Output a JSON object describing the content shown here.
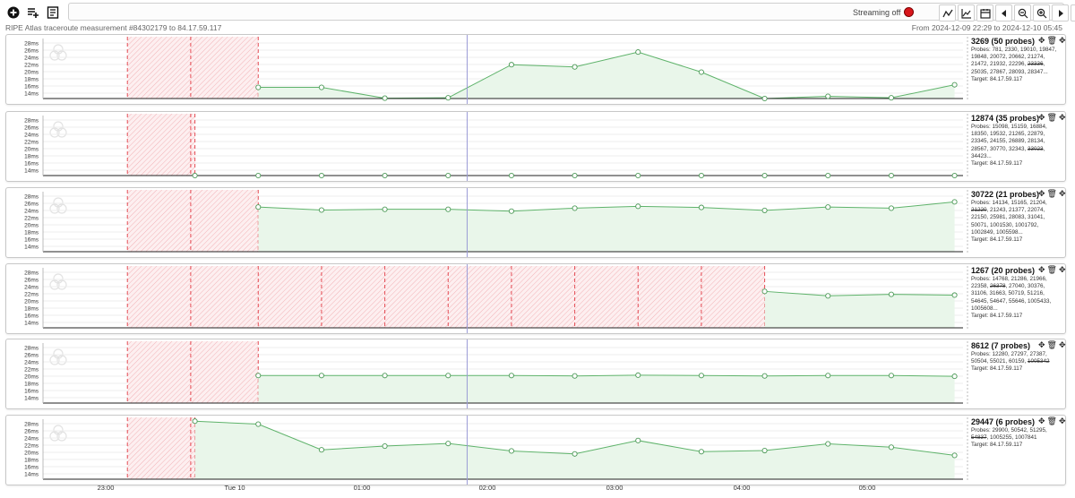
{
  "toolbar": {
    "left_buttons": [
      {
        "name": "add-probe-button",
        "icon": "plus-circle-icon"
      },
      {
        "name": "add-list-button",
        "icon": "playlist-add-icon"
      },
      {
        "name": "open-report-button",
        "icon": "document-icon"
      }
    ],
    "streaming_label": "Streaming off",
    "right_buttons": [
      {
        "name": "line-chart-button",
        "icon": "line-chart-icon"
      },
      {
        "name": "area-chart-button",
        "icon": "area-chart-icon"
      },
      {
        "name": "calendar-button",
        "icon": "calendar-icon"
      },
      {
        "name": "step-back-button",
        "icon": "caret-left-icon"
      },
      {
        "name": "zoom-out-button",
        "icon": "zoom-out-icon"
      },
      {
        "name": "zoom-in-button",
        "icon": "zoom-in-icon"
      },
      {
        "name": "step-forward-button",
        "icon": "caret-right-icon"
      },
      {
        "name": "skip-end-button",
        "icon": "skip-end-icon"
      }
    ]
  },
  "header": {
    "measurement_title": "RIPE Atlas traceroute measurement #84302179 to 84.17.59.117",
    "time_range": "From 2024-12-09 22:29 to 2024-12-10 05:45"
  },
  "colors": {
    "line": "#5fb36b",
    "fill": "#e9f6ea",
    "missing": "#e0303a",
    "cursor": "#9b9bd6",
    "streaming_dot": "#d8161b"
  },
  "axis": {
    "y_ticks": [
      "28ms",
      "26ms",
      "24ms",
      "22ms",
      "20ms",
      "18ms",
      "16ms",
      "14ms"
    ],
    "x_ticks": [
      "23:00",
      "Tue 10",
      "01:00",
      "02:00",
      "03:00",
      "04:00",
      "05:00"
    ]
  },
  "chart_data": [
    {
      "type": "area",
      "asn": "3269",
      "title": "3269 (50 probes)",
      "probes_text": "Probes: 781, 2330, 19010, 19847, 19848, 20072, 20662, 21274, 21472, 21932, 22296,",
      "probes_struck": "23336",
      "probes_tail": ", 25035, 27867, 28093, 28347...",
      "target": "Target: 84.17.59.117",
      "ylim": [
        13,
        29
      ],
      "x": [
        "00:11",
        "00:41",
        "01:11",
        "01:41",
        "02:11",
        "02:41",
        "03:11",
        "03:41",
        "04:11",
        "04:41",
        "05:11",
        "05:41"
      ],
      "values": [
        16.0,
        16.0,
        13.1,
        13.2,
        22.1,
        21.5,
        25.5,
        20.1,
        13.0,
        13.6,
        13.2,
        16.7
      ],
      "missing": [
        "23:09",
        "23:39",
        "00:11"
      ]
    },
    {
      "type": "area",
      "asn": "12874",
      "title": "12874 (35 probes)",
      "probes_text": "Probes: 15098, 15159, 16884, 18350, 19532, 21265, 22879, 23345, 24155, 26889, 28134, 28567, 30770, 32343,",
      "probes_struck": "33023",
      "probes_tail": ", 34423...",
      "target": "Target: 84.17.59.117",
      "ylim": [
        13,
        29
      ],
      "x": [
        "23:41",
        "00:11",
        "00:41",
        "01:11",
        "01:41",
        "02:11",
        "02:41",
        "03:11",
        "03:41",
        "04:11",
        "04:41",
        "05:11",
        "05:41"
      ],
      "values": [
        12.3,
        12.3,
        12.3,
        12.3,
        12.3,
        12.3,
        12.3,
        12.3,
        12.3,
        12.3,
        12.3,
        12.3,
        12.3
      ],
      "missing": [
        "23:09",
        "23:39",
        "23:41"
      ]
    },
    {
      "type": "area",
      "asn": "30722",
      "title": "30722 (21 probes)",
      "probes_text": "Probes: 14134, 15165, 21204,",
      "probes_struck": "21220",
      "probes_tail": ", 21243, 21377, 22074, 22150, 25981, 28083, 31041, 50071, 1001530, 1001792, 1002849, 1005598...",
      "target": "Target: 84.17.59.117",
      "ylim": [
        13,
        29
      ],
      "x": [
        "00:11",
        "00:41",
        "01:11",
        "01:41",
        "02:11",
        "02:41",
        "03:11",
        "03:41",
        "04:11",
        "04:41",
        "05:11",
        "05:41"
      ],
      "values": [
        25.0,
        24.2,
        24.4,
        24.4,
        23.9,
        24.7,
        25.2,
        24.9,
        24.1,
        25.0,
        24.7,
        26.4
      ],
      "missing": [
        "23:09",
        "23:39",
        "00:11"
      ]
    },
    {
      "type": "area",
      "asn": "1267",
      "title": "1267 (20 probes)",
      "probes_text": "Probes: 14768, 21286, 21966, 22358,",
      "probes_struck": "26378",
      "probes_tail": ", 27040, 30376, 31106, 31663, 50719, 51216, 54645, 54647, 55646, 1005433, 1005608...",
      "target": "Target: 84.17.59.117",
      "ylim": [
        13,
        29
      ],
      "x": [
        "04:11",
        "04:41",
        "05:11",
        "05:41"
      ],
      "values": [
        22.8,
        21.6,
        22.0,
        21.8
      ],
      "missing": [
        "23:09",
        "23:39",
        "00:11",
        "00:41",
        "01:11",
        "01:41",
        "02:11",
        "02:41",
        "03:11",
        "03:41",
        "04:11"
      ]
    },
    {
      "type": "area",
      "asn": "8612",
      "title": "8612 (7 probes)",
      "probes_text": "Probes: 12280, 27297, 27387, 50504, 55021, 60159,",
      "probes_struck": "1005342",
      "probes_tail": "",
      "target": "Target: 84.17.59.117",
      "ylim": [
        13,
        29
      ],
      "x": [
        "00:11",
        "00:41",
        "01:11",
        "01:41",
        "02:11",
        "02:41",
        "03:11",
        "03:41",
        "04:11",
        "04:41",
        "05:11",
        "05:41"
      ],
      "values": [
        20.4,
        20.4,
        20.4,
        20.4,
        20.4,
        20.3,
        20.5,
        20.4,
        20.3,
        20.4,
        20.4,
        20.2
      ],
      "missing": [
        "23:09",
        "23:39",
        "00:11"
      ]
    },
    {
      "type": "area",
      "asn": "29447",
      "title": "29447 (6 probes)",
      "probes_text": "Probes: 29900, 50542, 51295,",
      "probes_struck": "54837",
      "probes_tail": ", 1005255, 1007841",
      "target": "Target: 84.17.59.117",
      "ylim": [
        13,
        29
      ],
      "x": [
        "23:41",
        "00:11",
        "00:41",
        "01:11",
        "01:41",
        "02:11",
        "02:41",
        "03:11",
        "03:41",
        "04:11",
        "04:41",
        "05:11",
        "05:41"
      ],
      "values": [
        28.6,
        27.8,
        20.9,
        21.9,
        22.6,
        20.6,
        19.8,
        23.4,
        20.4,
        20.7,
        22.5,
        21.6,
        19.4
      ],
      "missing": [
        "23:09",
        "23:39",
        "23:41"
      ]
    }
  ]
}
